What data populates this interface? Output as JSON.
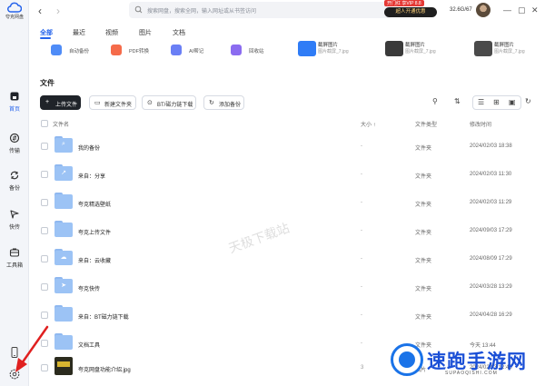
{
  "app": {
    "name": "夸克网盘"
  },
  "sidebar": {
    "items": [
      {
        "label": "首页",
        "icon": "home-icon",
        "active": true
      },
      {
        "label": "传输",
        "icon": "transfer-icon",
        "active": false
      },
      {
        "label": "备份",
        "icon": "backup-icon",
        "active": false
      },
      {
        "label": "快传",
        "icon": "quick-transfer-icon",
        "active": false
      },
      {
        "label": "工具箱",
        "icon": "toolbox-icon",
        "active": false
      }
    ],
    "bottom": [
      {
        "icon": "phone-icon"
      },
      {
        "icon": "settings-icon"
      }
    ]
  },
  "topbar": {
    "search_placeholder": "搜索网盘，搜索全网，输入网址或从书签访问",
    "vip_promo_title": "开门红 享VIP 8.8",
    "vip_button": "超人开通优惠",
    "storage": "32.6G/67"
  },
  "tabs": [
    "全部",
    "最近",
    "视频",
    "图片",
    "文档"
  ],
  "quick_tools": [
    {
      "label": "自动备份",
      "color": "#4f8cf7"
    },
    {
      "label": "PDF转换",
      "color": "#f56b4a"
    },
    {
      "label": "AI帮记",
      "color": "#6a7ff5"
    },
    {
      "label": "回收站",
      "color": "#8b6cf0"
    }
  ],
  "recent_files": [
    {
      "title": "截屏图片",
      "sub": "图片截屏_7.jpg"
    },
    {
      "title": "截屏图片",
      "sub": "图片截屏_7.jpg"
    },
    {
      "title": "截屏图片",
      "sub": "图片截屏_7.jpg"
    }
  ],
  "section": {
    "title": "文件"
  },
  "toolbar": {
    "upload": "上传文件",
    "new_folder": "新建文件夹",
    "bt_download": "BT/磁力链下载",
    "add_backup": "添加备份"
  },
  "table": {
    "headers": {
      "name": "文件名",
      "size": "大小",
      "type": "文件类型",
      "time": "修改时间"
    },
    "rows": [
      {
        "name": "我的备份",
        "size": "-",
        "type": "文件夹",
        "time": "2024/02/03 18:38",
        "icon": "backup-folder-icon"
      },
      {
        "name": "来自：分享",
        "size": "-",
        "type": "文件夹",
        "time": "2024/02/03 11:30",
        "icon": "share-folder-icon"
      },
      {
        "name": "夸克精选壁纸",
        "size": "-",
        "type": "文件夹",
        "time": "2024/02/03 11:29",
        "icon": "folder-icon"
      },
      {
        "name": "夸克上传文件",
        "size": "-",
        "type": "文件夹",
        "time": "2024/09/03 17:29",
        "icon": "folder-icon"
      },
      {
        "name": "来自：云收藏",
        "size": "-",
        "type": "文件夹",
        "time": "2024/08/09 17:29",
        "icon": "cloud-folder-icon"
      },
      {
        "name": "夸克快传",
        "size": "-",
        "type": "文件夹",
        "time": "2024/03/28 13:29",
        "icon": "quick-folder-icon"
      },
      {
        "name": "来自：BT磁力链下载",
        "size": "-",
        "type": "文件夹",
        "time": "2024/04/28 16:29",
        "icon": "bt-folder-icon"
      },
      {
        "name": "文档工具",
        "size": "-",
        "type": "文件夹",
        "time": "今天 13:44",
        "icon": "folder-icon"
      },
      {
        "name": "夸克网盘功能介绍.jpg",
        "size": "3",
        "type": "图片",
        "time": "2024/02/03 12:43",
        "icon": "image-file-icon"
      }
    ]
  },
  "watermarks": {
    "center": "天极下载站",
    "brand_title": "速跑手游网",
    "brand_sub": "SUPAOQISHI.COM"
  },
  "colors": {
    "accent": "#2563eb",
    "sidebar_bg": "#f3f5f9",
    "folder": "#9cc3f5",
    "annotation_arrow": "#e02020"
  }
}
